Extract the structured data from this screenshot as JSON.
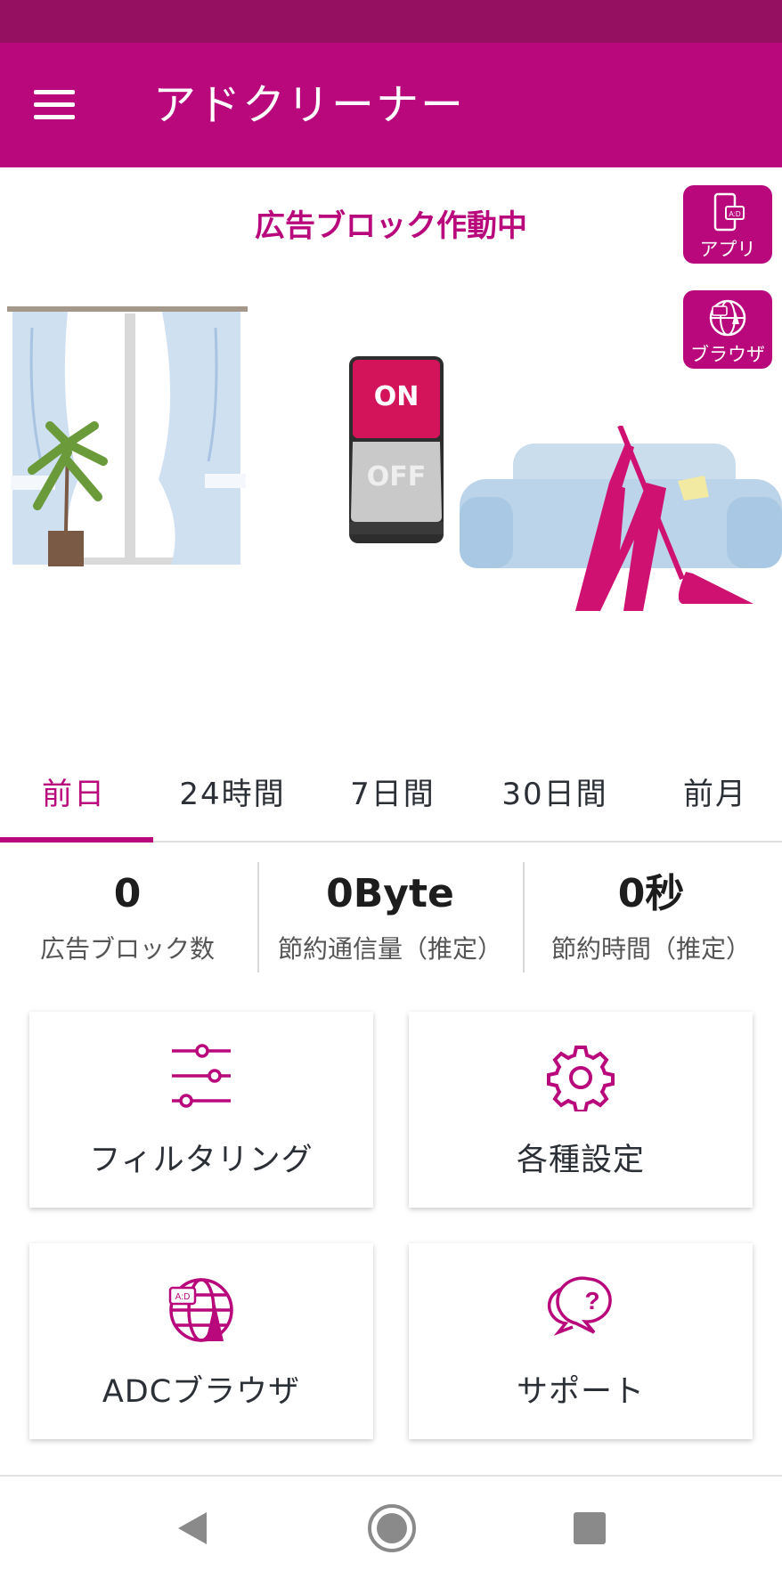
{
  "app": {
    "title": "アドクリーナー",
    "accent": "#b8087b"
  },
  "hero": {
    "status_text": "広告ブロック作動中",
    "toggle": {
      "on_label": "ON",
      "off_label": "OFF",
      "state": "on"
    }
  },
  "side_buttons": [
    {
      "label": "アプリ",
      "icon": "phone-ad-icon"
    },
    {
      "label": "ブラウザ",
      "icon": "globe-ad-icon"
    }
  ],
  "tabs": [
    {
      "label": "前日",
      "active": true
    },
    {
      "label": "24時間",
      "active": false
    },
    {
      "label": "7日間",
      "active": false
    },
    {
      "label": "30日間",
      "active": false
    },
    {
      "label": "前月",
      "active": false
    }
  ],
  "stats": [
    {
      "value": "0",
      "caption": "広告ブロック数"
    },
    {
      "value": "0Byte",
      "caption": "節約通信量（推定）"
    },
    {
      "value": "0秒",
      "caption": "節約時間（推定）"
    }
  ],
  "cards": [
    {
      "label": "フィルタリング",
      "icon": "sliders-icon"
    },
    {
      "label": "各種設定",
      "icon": "gear-icon"
    },
    {
      "label": "ADCブラウザ",
      "icon": "globe-browser-icon"
    },
    {
      "label": "サポート",
      "icon": "support-question-icon"
    }
  ],
  "nav": [
    "back-icon",
    "home-icon",
    "recents-icon"
  ]
}
